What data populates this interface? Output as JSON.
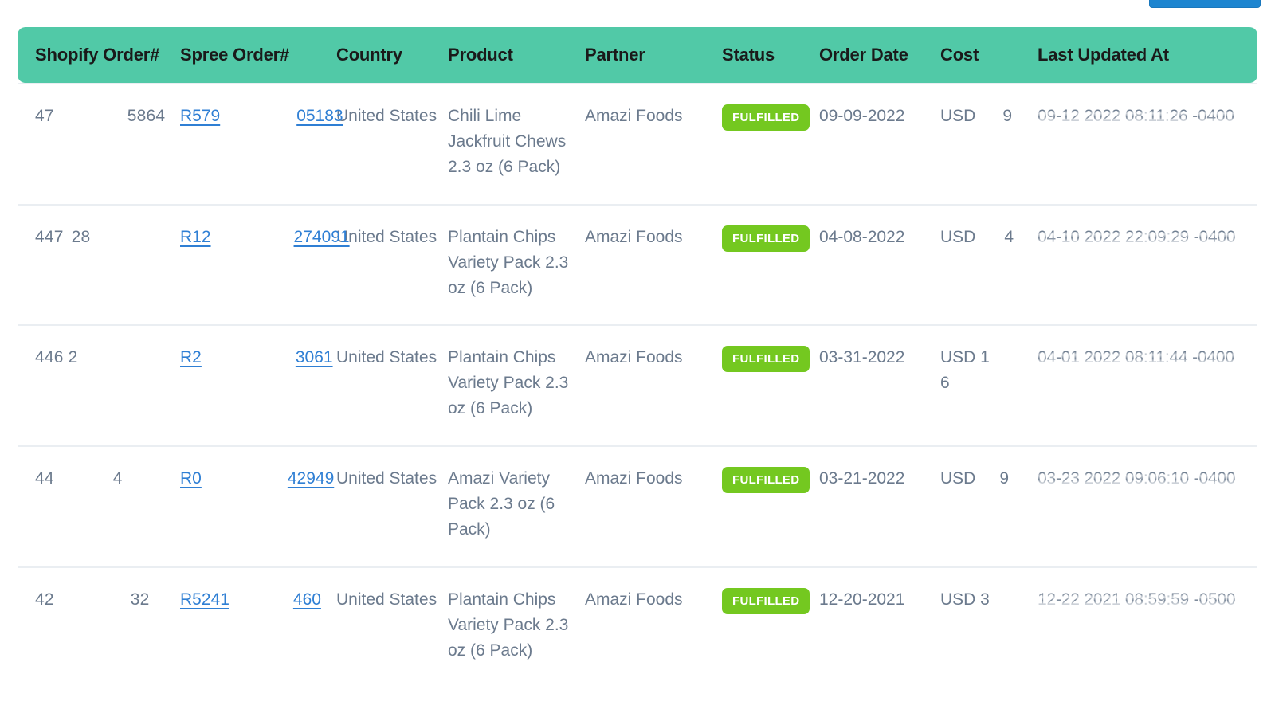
{
  "top_bar": {
    "button_label": ""
  },
  "table": {
    "columns": [
      "Shopify Order#",
      "Spree Order#",
      "Country",
      "Product",
      "Partner",
      "Status",
      "Order Date",
      "Cost",
      "Last Updated At"
    ],
    "rows": [
      {
        "shopify_prefix": "47",
        "shopify_suffix": "5864",
        "spree_prefix": "R579",
        "spree_suffix": "05183",
        "country": "United States",
        "product": "Chili Lime Jackfruit Chews 2.3 oz (6 Pack)",
        "partner": "Amazi Foods",
        "status": "FULFILLED",
        "order_date": "09-09-2022",
        "cost_prefix": "USD",
        "cost_suffix": "9",
        "last_updated": "09-12 2022 08:11:26 -0400"
      },
      {
        "shopify_prefix": "447",
        "shopify_suffix": "28",
        "spree_prefix": "R12",
        "spree_suffix": "274091",
        "country": "United States",
        "product": "Plantain Chips Variety Pack 2.3 oz (6 Pack)",
        "partner": "Amazi Foods",
        "status": "FULFILLED",
        "order_date": "04-08-2022",
        "cost_prefix": "USD",
        "cost_suffix": "4",
        "last_updated": "04-10 2022 22:09:29 -0400"
      },
      {
        "shopify_prefix": "446",
        "shopify_suffix": "2",
        "spree_prefix": "R2",
        "spree_suffix": "3061",
        "country": "United States",
        "product": "Plantain Chips Variety Pack 2.3 oz (6 Pack)",
        "partner": "Amazi Foods",
        "status": "FULFILLED",
        "order_date": "03-31-2022",
        "cost_prefix": "USD 1",
        "cost_suffix": "6",
        "last_updated": "04-01 2022 08:11:44 -0400"
      },
      {
        "shopify_prefix": "44",
        "shopify_suffix": "4",
        "spree_prefix": "R0",
        "spree_suffix": "42949",
        "country": "United States",
        "product": "Amazi Variety Pack 2.3 oz (6 Pack)",
        "partner": "Amazi Foods",
        "status": "FULFILLED",
        "order_date": "03-21-2022",
        "cost_prefix": "USD",
        "cost_suffix": "9",
        "last_updated": "03-23 2022 09:06:10 -0400"
      },
      {
        "shopify_prefix": "42",
        "shopify_suffix": "32",
        "spree_prefix": "R5241",
        "spree_suffix": "460",
        "country": "United States",
        "product": "Plantain Chips Variety Pack 2.3 oz (6 Pack)",
        "partner": "Amazi Foods",
        "status": "FULFILLED",
        "order_date": "12-20-2021",
        "cost_prefix": "USD 3",
        "cost_suffix": "",
        "last_updated": "12-22 2021 08:59:59 -0500"
      }
    ]
  },
  "colors": {
    "header_bg": "#51c9a7",
    "badge_green": "#74c820",
    "link_blue": "#2f7fd4",
    "body_text": "#6b7a8d",
    "row_divider": "#eaeef2",
    "top_button_blue": "#1d85d0"
  }
}
